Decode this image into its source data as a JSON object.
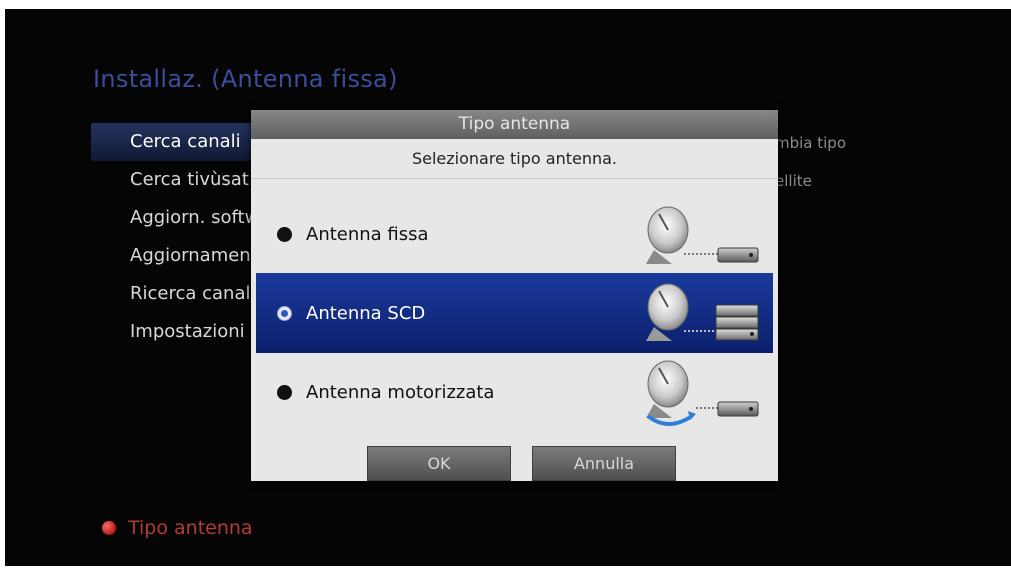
{
  "screen": {
    "title": "Installaz. (Antenna fissa)",
    "menu": [
      {
        "label": "Cerca canali"
      },
      {
        "label": "Cerca tivùsat"
      },
      {
        "label": "Aggiorn. software"
      },
      {
        "label": "Aggiornamento"
      },
      {
        "label": "Ricerca canali"
      },
      {
        "label": "Impostazioni"
      }
    ],
    "side_notes": [
      "mbia tipo",
      "ellite"
    ],
    "footer": {
      "label": "Tipo antenna",
      "color_key": "red"
    }
  },
  "dialog": {
    "title": "Tipo antenna",
    "message": "Selezionare tipo antenna.",
    "options": [
      {
        "label": "Antenna fissa",
        "selected": false,
        "icon": "satellite-dish-single-receiver-icon"
      },
      {
        "label": "Antenna SCD",
        "selected": true,
        "icon": "satellite-dish-stacked-receivers-icon"
      },
      {
        "label": "Antenna motorizzata",
        "selected": false,
        "icon": "satellite-dish-motorized-icon"
      }
    ],
    "ok_label": "OK",
    "cancel_label": "Annulla"
  },
  "colors": {
    "title_blue": "#3a4f9a",
    "highlight_blue": "#1b3a9c",
    "footer_red": "#b13d34"
  }
}
